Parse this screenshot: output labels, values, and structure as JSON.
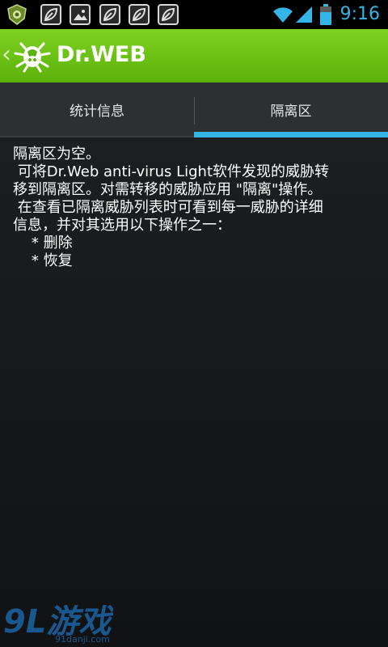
{
  "status_bar": {
    "time": "9:16",
    "time_color": "#33b5e5",
    "icons": [
      "drweb-shield-icon",
      "leaf-notification-icon",
      "image-notification-icon",
      "leaf-notification-icon",
      "leaf-notification-icon",
      "leaf-notification-icon",
      "wifi-icon",
      "signal-icon",
      "battery-icon"
    ]
  },
  "action_bar": {
    "title": "Dr.WEB",
    "back_glyph": "‹",
    "background": "#6cc219"
  },
  "tabs": [
    {
      "label": "统计信息",
      "selected": false
    },
    {
      "label": "隔离区",
      "selected": true
    }
  ],
  "accent_color": "#33b5e5",
  "content": {
    "lines": [
      "隔离区为空。",
      " 可将Dr.Web anti-virus Light软件发现的威胁转",
      "移到隔离区。对需转移的威胁应用 \"隔离\"操作。",
      " 在查看已隔离威胁列表时可看到每一威胁的详细",
      "信息，并对其选用以下操作之一：",
      "    * 删除",
      "    * 恢复"
    ]
  },
  "watermark": {
    "logo_text": "9L游戏",
    "url": "91danji.com"
  }
}
